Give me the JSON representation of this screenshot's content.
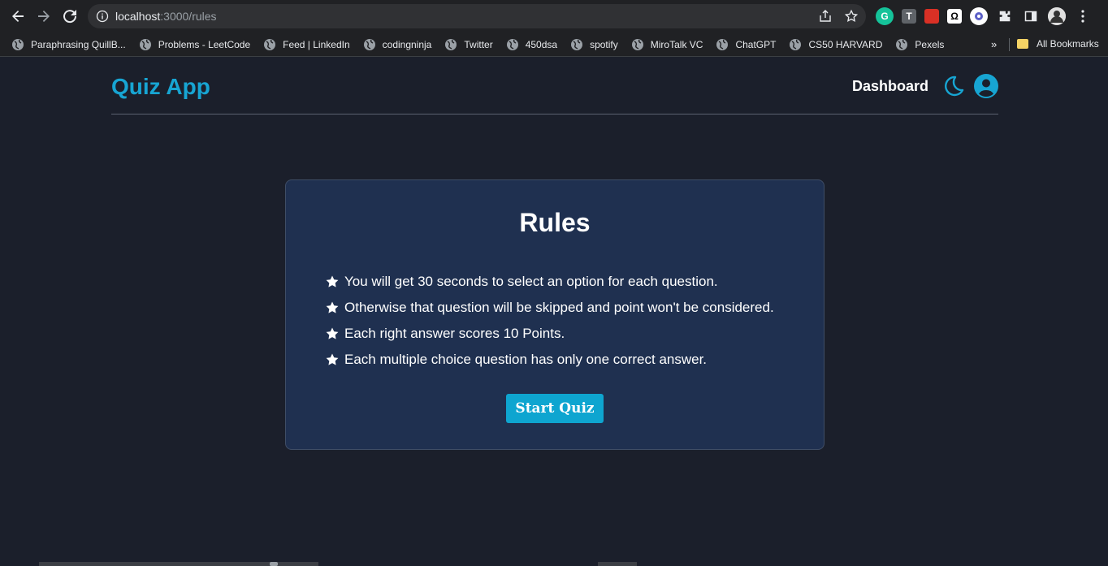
{
  "browser": {
    "url_host": "localhost",
    "url_path": ":3000/rules",
    "bookmarks": [
      "Paraphrasing QuillB...",
      "Problems - LeetCode",
      "Feed | LinkedIn",
      "codingninja",
      "Twitter",
      "450dsa",
      "spotify",
      "MiroTalk VC",
      "ChatGPT",
      "CS50 HARVARD",
      "Pexels"
    ],
    "overflow_label": "»",
    "all_bookmarks": "All Bookmarks",
    "ext_t_label": "T",
    "ext_omega_label": "Ω",
    "ext_g_label": "G"
  },
  "app": {
    "title": "Quiz App",
    "dashboard_label": "Dashboard",
    "accent_color": "#17a5d3"
  },
  "rules_card": {
    "title": "Rules",
    "items": [
      "You will get 30 seconds to select an option for each question.",
      "Otherwise that question will be skipped and point won't be considered.",
      "Each right answer scores 10 Points.",
      "Each multiple choice question has only one correct answer."
    ],
    "start_label": "Start Quiz"
  }
}
